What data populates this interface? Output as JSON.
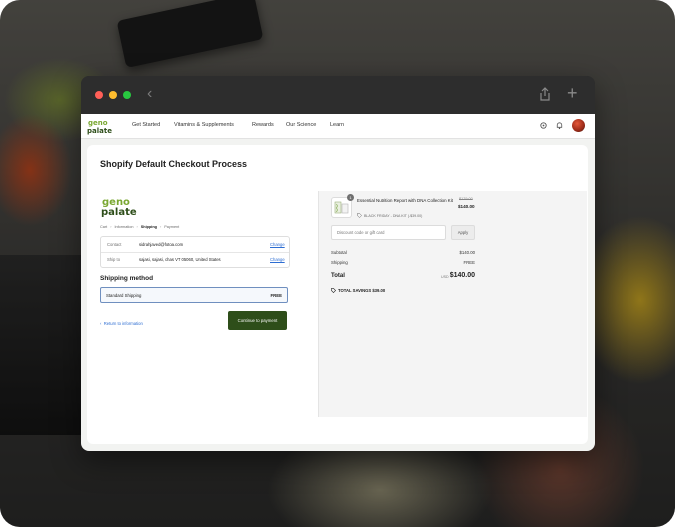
{
  "browser": {
    "back_glyph": "‹",
    "new_tab_glyph": "+"
  },
  "site": {
    "logo_text_top": "geno",
    "logo_text_bottom": "palate",
    "nav": [
      "Get Started",
      "Vitamins & Supplements",
      "Rewards",
      "Our Science",
      "Learn"
    ]
  },
  "page": {
    "title": "Shopify Default Checkout Process"
  },
  "checkout": {
    "breadcrumb": [
      "Cart",
      "Information",
      "Shipping",
      "Payment"
    ],
    "breadcrumb_current": "Shipping",
    "review": [
      {
        "label": "Contact",
        "value": "sidrahjaved@fotoa.com",
        "action": "Change"
      },
      {
        "label": "Ship to",
        "value": "sajasi, sajasi, chas VT 05060, United States",
        "action": "Change"
      }
    ],
    "shipping_heading": "Shipping method",
    "shipping_option": {
      "name": "Standard Shipping",
      "price": "FREE"
    },
    "return_link": "Return to information",
    "continue_button": "Continue to payment"
  },
  "summary": {
    "product": {
      "quantity": "1",
      "name": "Essential Nutrition Report with DNA Collection Kit",
      "discount": "BLACK FRIDAY - DNA KIT (-$39.00)",
      "original_price": "$179.00",
      "price": "$140.00"
    },
    "discount_placeholder": "Discount code or gift card",
    "apply_button": "Apply",
    "subtotal_label": "Subtotal",
    "subtotal_value": "$140.00",
    "shipping_label": "Shipping",
    "shipping_value": "FREE",
    "total_label": "Total",
    "currency": "USD",
    "total_value": "$140.00",
    "savings": "TOTAL SAVINGS  $39.00"
  },
  "colors": {
    "brand_green": "#6a9a2a",
    "button_dark_green": "#2e4e1a",
    "link_blue": "#2d6dd2"
  }
}
